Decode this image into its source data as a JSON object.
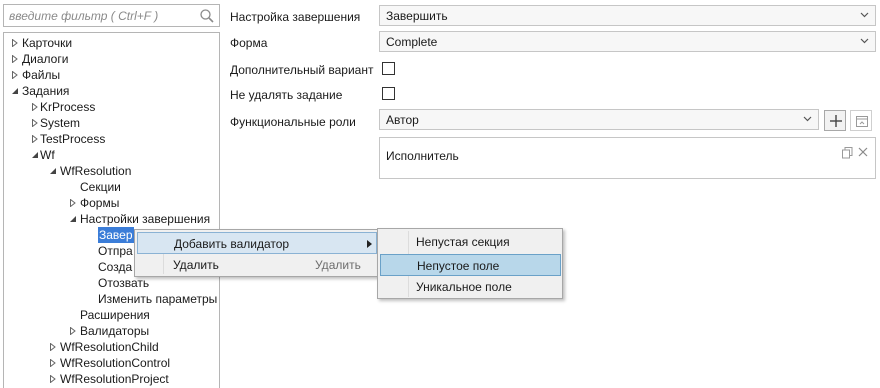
{
  "filter": {
    "placeholder": "введите фильтр   ( Ctrl+F )",
    "icon": "search-icon"
  },
  "tree": [
    {
      "label": "Карточки",
      "level": 0,
      "expanded": false,
      "has_children": true
    },
    {
      "label": "Диалоги",
      "level": 0,
      "expanded": false,
      "has_children": true
    },
    {
      "label": "Файлы",
      "level": 0,
      "expanded": false,
      "has_children": true
    },
    {
      "label": "Задания",
      "level": 0,
      "expanded": true,
      "has_children": true
    },
    {
      "label": "KrProcess",
      "level": 1,
      "expanded": false,
      "has_children": true
    },
    {
      "label": "System",
      "level": 1,
      "expanded": false,
      "has_children": true
    },
    {
      "label": "TestProcess",
      "level": 1,
      "expanded": false,
      "has_children": true
    },
    {
      "label": "Wf",
      "level": 1,
      "expanded": true,
      "has_children": true
    },
    {
      "label": "WfResolution",
      "level": 2,
      "expanded": true,
      "has_children": true
    },
    {
      "label": "Секции",
      "level": 3,
      "expanded": false,
      "has_children": false
    },
    {
      "label": "Формы",
      "level": 3,
      "expanded": false,
      "has_children": true
    },
    {
      "label": "Настройки завершения",
      "level": 3,
      "expanded": true,
      "has_children": true
    },
    {
      "label": "Завер",
      "level": 4,
      "expanded": false,
      "has_children": false,
      "selected": true
    },
    {
      "label": "Отпра",
      "level": 4,
      "expanded": false,
      "has_children": false
    },
    {
      "label": "Созда",
      "level": 4,
      "expanded": false,
      "has_children": false
    },
    {
      "label": "Отозвать",
      "level": 4,
      "expanded": false,
      "has_children": false
    },
    {
      "label": "Изменить параметры",
      "level": 4,
      "expanded": false,
      "has_children": false
    },
    {
      "label": "Расширения",
      "level": 3,
      "expanded": false,
      "has_children": false
    },
    {
      "label": "Валидаторы",
      "level": 3,
      "expanded": false,
      "has_children": true
    },
    {
      "label": "WfResolutionChild",
      "level": 2,
      "expanded": false,
      "has_children": true
    },
    {
      "label": "WfResolutionControl",
      "level": 2,
      "expanded": false,
      "has_children": true
    },
    {
      "label": "WfResolutionProject",
      "level": 2,
      "expanded": false,
      "has_children": true
    }
  ],
  "form": {
    "completion_setting": {
      "label": "Настройка завершения",
      "value": "Завершить"
    },
    "form_field": {
      "label": "Форма",
      "value": "Complete"
    },
    "additional_option": {
      "label": "Дополнительный вариант",
      "checked": false
    },
    "dont_delete_task": {
      "label": "Не удалять задание",
      "checked": false
    },
    "functional_roles": {
      "label": "Функциональные роли",
      "value": "Автор",
      "items": [
        "Исполнитель"
      ]
    }
  },
  "context_menu": {
    "items": [
      {
        "label": "Добавить валидатор",
        "gesture": "",
        "has_submenu": true,
        "highlighted": true
      },
      {
        "label": "Удалить",
        "gesture": "Удалить",
        "has_submenu": false,
        "highlighted": false
      }
    ]
  },
  "submenu": {
    "items": [
      {
        "label": "Непустая секция",
        "highlighted": false
      },
      {
        "label": "Непустое поле",
        "highlighted": true
      },
      {
        "label": "Уникальное поле",
        "highlighted": false
      }
    ]
  },
  "colors": {
    "selection": "#3b7dd8",
    "menu_highlight": "#b8d7ea",
    "menu_border": "#a7a7a7"
  }
}
